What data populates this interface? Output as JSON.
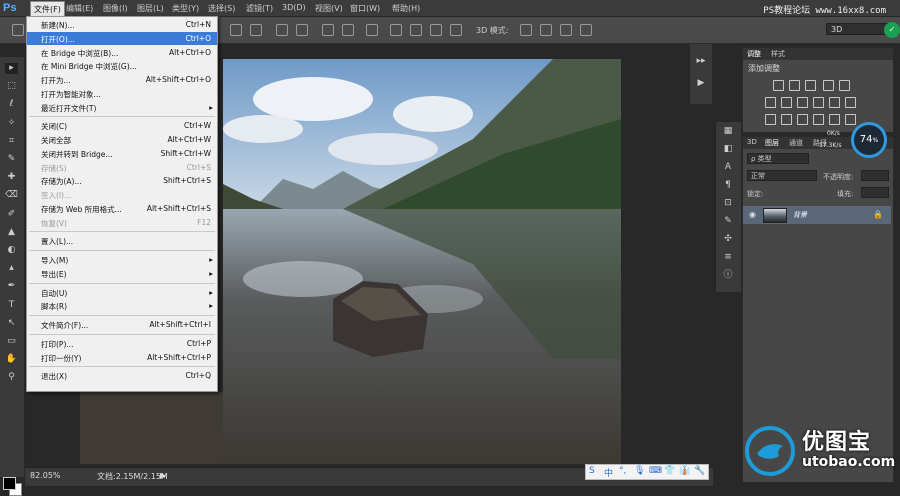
{
  "app": {
    "logo": "Ps"
  },
  "menubar": {
    "items": [
      "文件(F)",
      "编辑(E)",
      "图像(I)",
      "图层(L)",
      "类型(Y)",
      "选择(S)",
      "滤镜(T)",
      "3D(D)",
      "视图(V)",
      "窗口(W)",
      "帮助(H)"
    ],
    "watermark": "PS教程论坛 www.16xx8.com"
  },
  "options": {
    "mode_label": "3D 模式:",
    "workspace": "3D",
    "badge": "✓"
  },
  "file_menu": [
    {
      "label": "新建(N)...",
      "shortcut": "Ctrl+N"
    },
    {
      "label": "打开(O)...",
      "shortcut": "Ctrl+O",
      "highlight": true
    },
    {
      "label": "在 Bridge 中浏览(B)...",
      "shortcut": "Alt+Ctrl+O"
    },
    {
      "label": "在 Mini Bridge 中浏览(G)...",
      "shortcut": ""
    },
    {
      "label": "打开为...",
      "shortcut": "Alt+Shift+Ctrl+O"
    },
    {
      "label": "打开为智能对象...",
      "shortcut": ""
    },
    {
      "label": "最近打开文件(T)",
      "shortcut": "",
      "submenu": true
    },
    {
      "sep": true
    },
    {
      "label": "关闭(C)",
      "shortcut": "Ctrl+W"
    },
    {
      "label": "关闭全部",
      "shortcut": "Alt+Ctrl+W"
    },
    {
      "label": "关闭并转到 Bridge...",
      "shortcut": "Shift+Ctrl+W"
    },
    {
      "label": "存储(S)",
      "shortcut": "Ctrl+S",
      "disabled": true
    },
    {
      "label": "存储为(A)...",
      "shortcut": "Shift+Ctrl+S"
    },
    {
      "label": "签入(I)...",
      "shortcut": "",
      "disabled": true
    },
    {
      "label": "存储为 Web 所用格式...",
      "shortcut": "Alt+Shift+Ctrl+S"
    },
    {
      "label": "恢复(V)",
      "shortcut": "F12",
      "disabled": true
    },
    {
      "sep": true
    },
    {
      "label": "置入(L)...",
      "shortcut": ""
    },
    {
      "sep": true
    },
    {
      "label": "导入(M)",
      "shortcut": "",
      "submenu": true
    },
    {
      "label": "导出(E)",
      "shortcut": "",
      "submenu": true
    },
    {
      "sep": true
    },
    {
      "label": "自动(U)",
      "shortcut": "",
      "submenu": true
    },
    {
      "label": "脚本(R)",
      "shortcut": "",
      "submenu": true
    },
    {
      "sep": true
    },
    {
      "label": "文件简介(F)...",
      "shortcut": "Alt+Shift+Ctrl+I"
    },
    {
      "sep": true
    },
    {
      "label": "打印(P)...",
      "shortcut": "Ctrl+P"
    },
    {
      "label": "打印一份(Y)",
      "shortcut": "Alt+Shift+Ctrl+P"
    },
    {
      "sep": true
    },
    {
      "label": "退出(X)",
      "shortcut": "Ctrl+Q"
    }
  ],
  "status": {
    "zoom": "82.05%",
    "doc": "文档:2.15M/2.15M",
    "arrow": "▶"
  },
  "ime": [
    "S",
    "中",
    "°,",
    "🎙",
    "⌨",
    "👕",
    "👔",
    "🔧"
  ],
  "adjust_panel": {
    "tabs": [
      "调整",
      "样式"
    ],
    "title": "添加调整"
  },
  "layers_panel": {
    "tabs": [
      "3D",
      "图层",
      "通道",
      "路径"
    ],
    "filter": "ρ 类型",
    "blend_mode": "正常",
    "opacity_label": "不透明度:",
    "lock_label": "锁定:",
    "fill_label": "填充:",
    "layer_name": "背景"
  },
  "perf": {
    "percent": "74",
    "unit": "%",
    "up": "0K/s",
    "down": "17.3K/s"
  },
  "watermark_bottom": {
    "title": "优图宝",
    "url": "utobao.com"
  },
  "tools": [
    "▸",
    "⬚",
    "ℓ",
    "✧",
    "⌗",
    "✎",
    "✚",
    "⌫",
    "✐",
    "▲",
    "◐",
    "▴",
    "✒",
    "T",
    "↖",
    "▭",
    "✋",
    "⚲"
  ],
  "icon_strip": [
    "▦",
    "◧",
    "A",
    "¶",
    "⊡",
    "✎",
    "✣",
    "≡",
    "ⓘ"
  ],
  "dock": [
    "▸▸",
    "▶"
  ],
  "colors": {
    "menu_highlight": "#3b7bd8",
    "layer_selected": "#596779",
    "accent": "#2f9adf"
  }
}
